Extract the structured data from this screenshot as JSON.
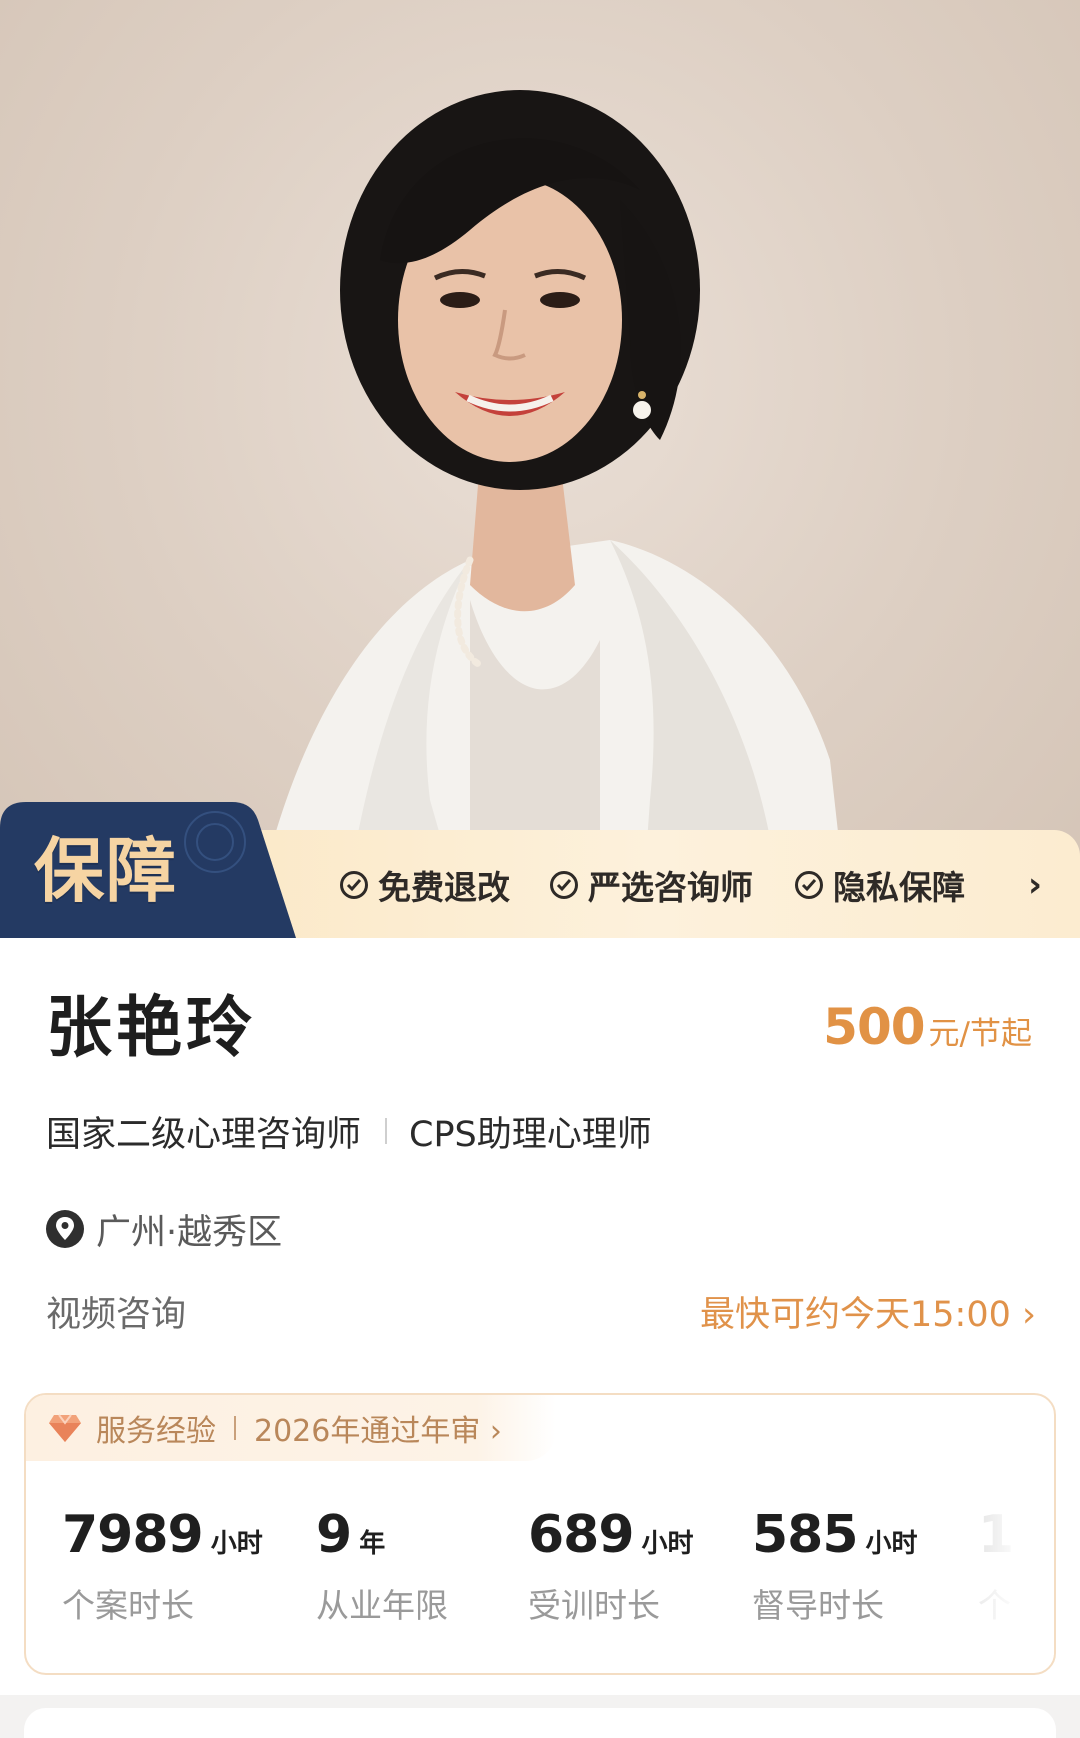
{
  "guarantee": {
    "badge": "保障",
    "items": [
      "免费退改",
      "严选咨询师",
      "隐私保障"
    ],
    "more_icon": "chevron-right-icon"
  },
  "counselor": {
    "name": "张艳玲",
    "price": "500",
    "price_unit": "元/节起",
    "titles": [
      "国家二级心理咨询师",
      "CPS助理心理师"
    ],
    "location": "广州·越秀区",
    "mode": "视频咨询",
    "soonest": "最快可约今天15:00 ›"
  },
  "experience": {
    "label": "服务经验",
    "audit": "2026年通过年审 ›",
    "stats": [
      {
        "value": "7989",
        "unit": "小时",
        "label": "个案时长"
      },
      {
        "value": "9",
        "unit": "年",
        "label": "从业年限"
      },
      {
        "value": "689",
        "unit": "小时",
        "label": "受训时长"
      },
      {
        "value": "585",
        "unit": "小时",
        "label": "督导时长"
      },
      {
        "value": "1",
        "unit": "",
        "label": "个"
      }
    ]
  },
  "colors": {
    "accent": "#e19245",
    "badge_bg": "#243a63",
    "banner_bg": "#fbe9c8",
    "exp_text": "#b9875a"
  }
}
